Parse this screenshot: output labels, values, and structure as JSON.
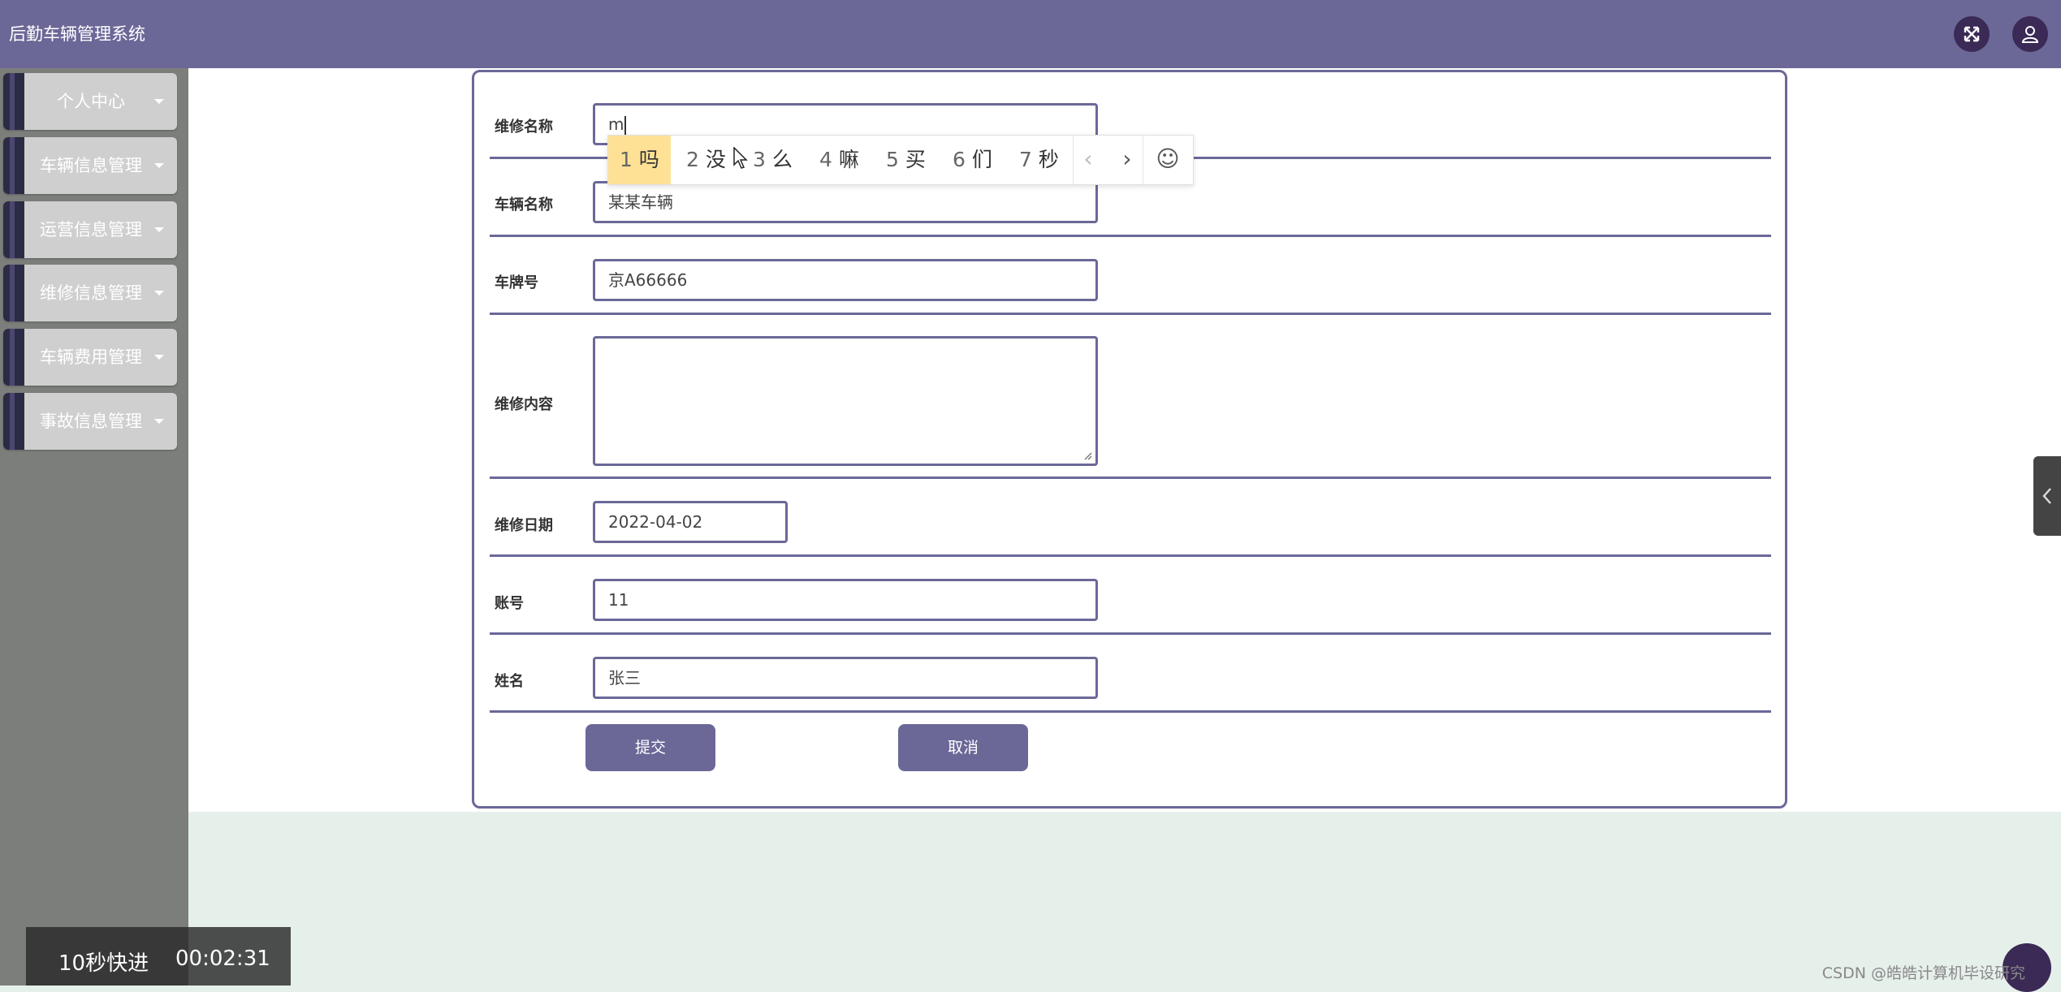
{
  "app": {
    "title": "后勤车辆管理系统"
  },
  "topbar": {
    "icons": [
      "fullscreen-icon",
      "user-icon"
    ]
  },
  "sidebar": {
    "items": [
      {
        "label": "个人中心"
      },
      {
        "label": "车辆信息管理"
      },
      {
        "label": "运营信息管理"
      },
      {
        "label": "维修信息管理"
      },
      {
        "label": "车辆费用管理"
      },
      {
        "label": "事故信息管理"
      }
    ]
  },
  "form": {
    "fields": [
      {
        "label": "维修名称",
        "value": "m"
      },
      {
        "label": "车辆名称",
        "value": "某某车辆"
      },
      {
        "label": "车牌号",
        "value": "京A66666"
      },
      {
        "label": "维修内容",
        "value": ""
      },
      {
        "label": "维修日期",
        "value": "2022-04-02"
      },
      {
        "label": "账号",
        "value": "11"
      },
      {
        "label": "姓名",
        "value": "张三"
      }
    ],
    "submit_label": "提交",
    "cancel_label": "取消"
  },
  "ime": {
    "candidates": [
      {
        "num": "1",
        "text": "吗"
      },
      {
        "num": "2",
        "text": "没"
      },
      {
        "num": "3",
        "text": "么"
      },
      {
        "num": "4",
        "text": "嘛"
      },
      {
        "num": "5",
        "text": "买"
      },
      {
        "num": "6",
        "text": "们"
      },
      {
        "num": "7",
        "text": "秒"
      }
    ],
    "selected_index": 0,
    "prev": "‹",
    "next": "›",
    "emoji": "☺"
  },
  "overlay": {
    "skip_label": "10秒快进",
    "time": "00:02:31"
  },
  "watermark": "CSDN @皓皓计算机毕设研究"
}
